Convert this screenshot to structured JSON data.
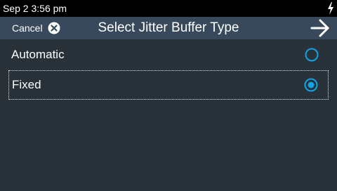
{
  "status_bar": {
    "time": "Sep 2 3:56 pm",
    "power_icon": "lightning-bolt-icon"
  },
  "title_bar": {
    "cancel_label": "Cancel",
    "cancel_icon": "close-circle-icon",
    "title": "Select Jitter Buffer Type",
    "next_icon": "arrow-right-icon"
  },
  "options": [
    {
      "label": "Automatic",
      "selected": false
    },
    {
      "label": "Fixed",
      "selected": true
    }
  ],
  "colors": {
    "background": "#283238",
    "title_bar": "#37495a",
    "status_bar": "#000000",
    "radio_accent": "#0fa4e6"
  }
}
